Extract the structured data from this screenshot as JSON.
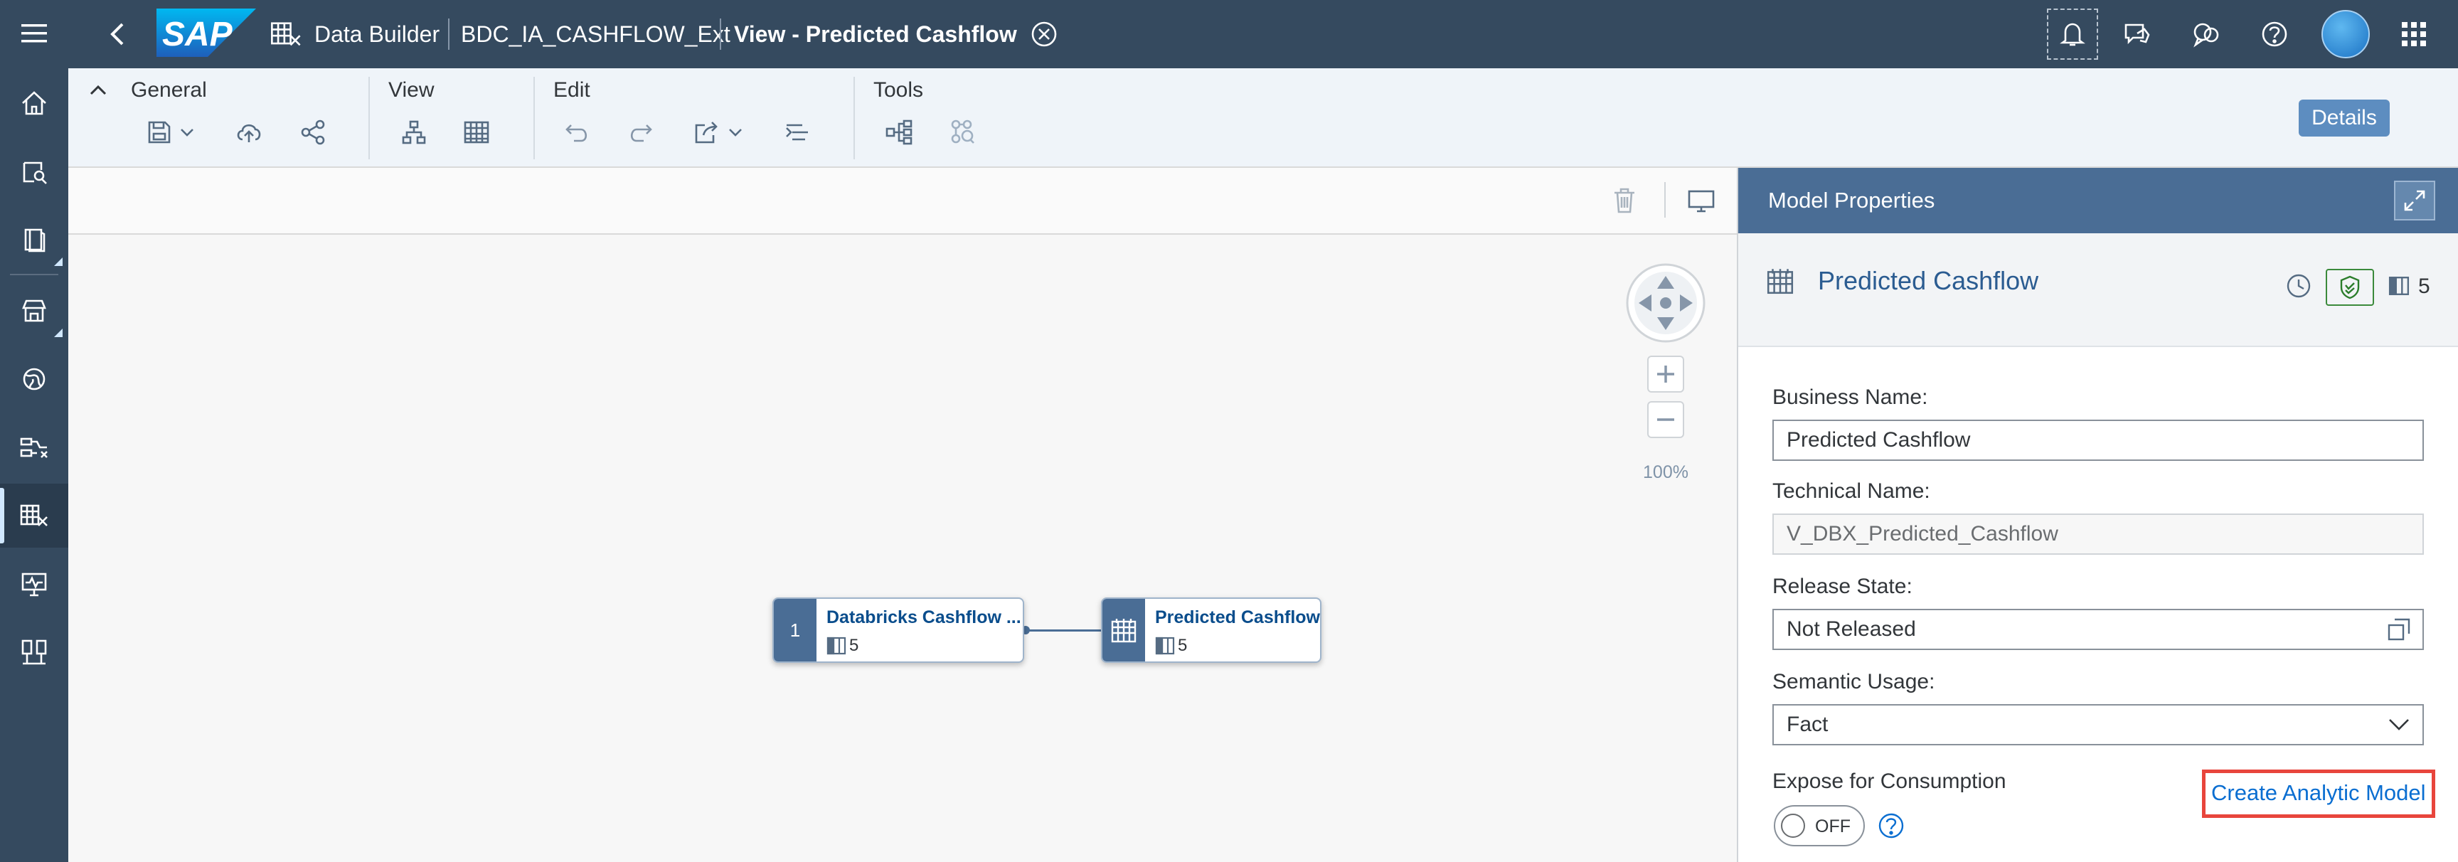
{
  "shell": {
    "app_name": "Data Builder",
    "space": "BDC_IA_CASHFLOW_Ext",
    "view_title": "View - Predicted Cashflow",
    "logo_text": "SAP"
  },
  "toolbar": {
    "groups": [
      {
        "label": "General"
      },
      {
        "label": "View"
      },
      {
        "label": "Edit"
      },
      {
        "label": "Tools"
      }
    ],
    "details_label": "Details"
  },
  "canvas": {
    "zoom": "100%",
    "nodes": [
      {
        "badge": "1",
        "title": "Databricks Cashflow ...",
        "columns": "5"
      },
      {
        "title": "Predicted Cashflow",
        "columns": "5"
      }
    ]
  },
  "panel": {
    "header": "Model Properties",
    "object_name": "Predicted Cashflow",
    "column_count": "5",
    "business_name_label": "Business Name:",
    "business_name": "Predicted Cashflow",
    "technical_name_label": "Technical Name:",
    "technical_name": "V_DBX_Predicted_Cashflow",
    "release_state_label": "Release State:",
    "release_state": "Not Released",
    "semantic_usage_label": "Semantic Usage:",
    "semantic_usage": "Fact",
    "expose_label": "Expose for Consumption",
    "toggle_state": "OFF",
    "create_link": "Create Analytic Model"
  },
  "colors": {
    "shell_bg": "#354a5f",
    "toolbar_bg": "#eff4f9",
    "panel_header_bg": "#4a6d95",
    "link": "#0a6ed1",
    "highlight": "#e8453c"
  }
}
